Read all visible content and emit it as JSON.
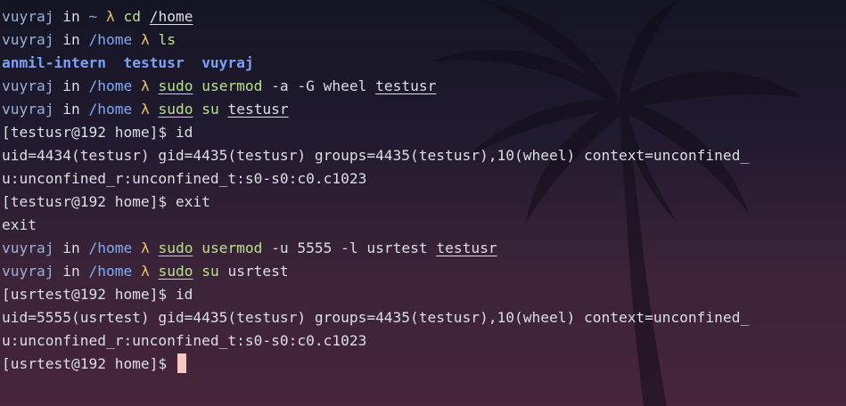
{
  "terminal": {
    "lines": [
      {
        "type": "prompt",
        "user": "vuyraj",
        "in": "in",
        "path": "~",
        "lam": "λ",
        "cmd": "cd",
        "args": " ",
        "arg_ul": "/home",
        "rest": ""
      },
      {
        "type": "prompt",
        "user": "vuyraj",
        "in": "in",
        "path": "/home",
        "lam": "λ",
        "cmd": "ls",
        "args": "",
        "arg_ul": "",
        "rest": ""
      },
      {
        "type": "dirs",
        "items": [
          "anmil-intern",
          "testusr",
          "vuyraj"
        ]
      },
      {
        "type": "prompt",
        "user": "vuyraj",
        "in": "in",
        "path": "/home",
        "lam": "λ",
        "cmd_ul": "sudo",
        "cmd": "usermod",
        "args": " -a -G wheel ",
        "arg_ul": "testusr",
        "rest": ""
      },
      {
        "type": "prompt",
        "user": "vuyraj",
        "in": "in",
        "path": "/home",
        "lam": "λ",
        "cmd_ul": "sudo",
        "cmd": "su",
        "args": " ",
        "arg_ul": "testusr",
        "rest": ""
      },
      {
        "type": "text",
        "text": "[testusr@192 home]$ id"
      },
      {
        "type": "text",
        "text": "uid=4434(testusr) gid=4435(testusr) groups=4435(testusr),10(wheel) context=unconfined_"
      },
      {
        "type": "text",
        "text": "u:unconfined_r:unconfined_t:s0-s0:c0.c1023"
      },
      {
        "type": "text",
        "text": "[testusr@192 home]$ exit"
      },
      {
        "type": "text",
        "text": "exit"
      },
      {
        "type": "prompt",
        "user": "vuyraj",
        "in": "in",
        "path": "/home",
        "lam": "λ",
        "cmd_ul": "sudo",
        "cmd": "usermod",
        "args": " -u 5555 -l usrtest ",
        "arg_ul": "testusr",
        "rest": ""
      },
      {
        "type": "prompt",
        "user": "vuyraj",
        "in": "in",
        "path": "/home",
        "lam": "λ",
        "cmd_ul": "sudo",
        "cmd": "su",
        "args": " usrtest",
        "arg_ul": "",
        "rest": ""
      },
      {
        "type": "text",
        "text": "[usrtest@192 home]$ id"
      },
      {
        "type": "text",
        "text": "uid=5555(usrtest) gid=4435(testusr) groups=4435(testusr),10(wheel) context=unconfined_"
      },
      {
        "type": "text",
        "text": "u:unconfined_r:unconfined_t:s0-s0:c0.c1023"
      },
      {
        "type": "final",
        "text": "[usrtest@192 home]$ "
      }
    ]
  },
  "colors": {
    "user": "#9ab0d8",
    "path": "#82aaf0",
    "lambda": "#e8c26a",
    "command": "#b8e08a",
    "dir": "#7aa2f7",
    "cursor": "#f4c7c0"
  },
  "icons": {
    "background": "palm-tree-silhouette"
  }
}
